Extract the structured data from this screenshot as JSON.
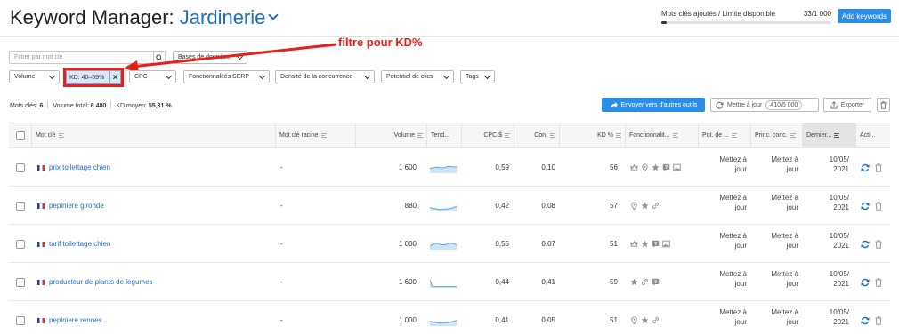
{
  "header": {
    "title_prefix": "Keyword Manager:",
    "project_name": "Jardinerie",
    "limit_label": "Mots clés ajoutés / Limite disponible",
    "limit_count": "33/1 000",
    "limit_progress": 0.033,
    "add_button": "Add keywords"
  },
  "filters": {
    "search_placeholder": "Filtrer par mot clé",
    "databases_label": "Bases de données",
    "row2": [
      "Volume",
      "CPC",
      "Fonctionnalités SERP",
      "Densité de la concurrence",
      "Potentiel de clics",
      "Tags"
    ],
    "active_chip": "KD: 40–59%",
    "annotation": "filtre pour KD%"
  },
  "stats": {
    "keywords_label": "Mots clés:",
    "keywords_value": "6",
    "volume_label": "Volume total:",
    "volume_value": "8 480",
    "kd_label": "KD moyen:",
    "kd_value": "55,31 %"
  },
  "actions": {
    "send": "Envoyer vers d'autres outils",
    "update": "Mettre à jour",
    "update_count": "410/5 000",
    "export": "Exporter"
  },
  "table": {
    "headers": {
      "keyword": "Mot clé",
      "root": "Mot clé racine",
      "volume": "Volume",
      "trend": "Tend...",
      "cpc": "CPC $",
      "com": "Con.",
      "kd": "KD %",
      "features": "Fonctionnalit...",
      "potential": "Pot. de ...",
      "competitors": "Princ. conc.",
      "last": "Dernier...",
      "actions": "Acti..."
    },
    "rows": [
      {
        "keyword": "prix toilettage chien",
        "root": "-",
        "volume": "1 600",
        "cpc": "0,59",
        "com": "0,10",
        "kd": "56",
        "pot_1": "Mettez à",
        "pot_2": "jour",
        "conc_1": "Mettez à",
        "conc_2": "jour",
        "date_1": "10/05/",
        "date_2": "2021",
        "features": [
          "crown-icon",
          "pin-icon",
          "star-icon",
          "faq-icon",
          "image-icon"
        ],
        "trend": [
          0.5,
          0.55,
          0.6,
          0.65,
          0.6,
          0.55,
          0.6,
          0.7,
          0.75,
          0.7,
          0.65,
          0.7
        ]
      },
      {
        "keyword": "pepiniere gironde",
        "root": "-",
        "volume": "880",
        "cpc": "0,42",
        "com": "0,08",
        "kd": "57",
        "pot_1": "Mettez à",
        "pot_2": "jour",
        "conc_1": "Mettez à",
        "conc_2": "jour",
        "date_1": "10/05/",
        "date_2": "2021",
        "features": [
          "pin-icon",
          "star-icon",
          "link-icon"
        ],
        "trend": [
          0.35,
          0.3,
          0.25,
          0.2,
          0.15,
          0.15,
          0.2,
          0.2,
          0.25,
          0.3,
          0.4,
          0.55
        ]
      },
      {
        "keyword": "tarif toilettage chien",
        "root": "-",
        "volume": "1 000",
        "cpc": "0,55",
        "com": "0,07",
        "kd": "51",
        "pot_1": "Mettez à",
        "pot_2": "jour",
        "conc_1": "Mettez à",
        "conc_2": "jour",
        "date_1": "10/05/",
        "date_2": "2021",
        "features": [
          "crown-icon",
          "star-icon",
          "faq-icon",
          "image-icon"
        ],
        "trend": [
          0.4,
          0.5,
          0.65,
          0.7,
          0.6,
          0.5,
          0.5,
          0.55,
          0.7,
          0.7,
          0.6,
          0.5
        ]
      },
      {
        "keyword": "producteur de plants de legumes",
        "root": "-",
        "volume": "1 600",
        "cpc": "0,44",
        "com": "0,41",
        "kd": "59",
        "pot_1": "Mettez à",
        "pot_2": "jour",
        "conc_1": "Mettez à",
        "conc_2": "jour",
        "date_1": "10/05/",
        "date_2": "2021",
        "features": [
          "star-icon",
          "link-icon",
          "faq-icon"
        ],
        "trend": [
          0.9,
          0.1,
          0.05,
          0.05,
          0.05,
          0.05,
          0.05,
          0.05,
          0.05,
          0.05,
          0.05,
          0.05
        ]
      },
      {
        "keyword": "pepiniere rennes",
        "root": "-",
        "volume": "1 000",
        "cpc": "0,41",
        "com": "0,05",
        "kd": "51",
        "pot_1": "Mettez à",
        "pot_2": "jour",
        "conc_1": "Mettez à",
        "conc_2": "jour",
        "date_1": "10/05/",
        "date_2": "2021",
        "features": [
          "pin-icon",
          "star-icon",
          "link-icon"
        ],
        "trend": [
          0.5,
          0.4,
          0.35,
          0.3,
          0.25,
          0.25,
          0.3,
          0.3,
          0.35,
          0.4,
          0.5,
          0.6
        ]
      }
    ]
  },
  "colors": {
    "accent": "#2b8de6",
    "link": "#1e6fc0",
    "annotation": "#e8201a",
    "trend_fill": "#cfe5f7",
    "trend_line": "#5aa9e6"
  }
}
